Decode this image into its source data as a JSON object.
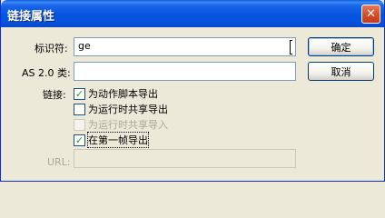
{
  "dialog": {
    "title": "链接属性",
    "close_glyph": "✕"
  },
  "fields": {
    "identifier_label": "标识符:",
    "identifier_value": "ge",
    "as_class_label": "AS 2.0 类:",
    "as_class_value": "",
    "linkage_label": "链接:",
    "url_label": "URL:",
    "url_value": ""
  },
  "buttons": {
    "ok": "确定",
    "cancel": "取消"
  },
  "checkboxes": [
    {
      "label": "为动作脚本导出",
      "checked": true,
      "enabled": true
    },
    {
      "label": "为运行时共享导出",
      "checked": false,
      "enabled": true
    },
    {
      "label": "为运行时共享导入",
      "checked": false,
      "enabled": false
    },
    {
      "label": "在第一帧导出",
      "checked": true,
      "enabled": true
    }
  ],
  "colors": {
    "titlebar": "#0455de",
    "dialog_bg": "#ece9d8",
    "checkmark": "#21a121"
  }
}
